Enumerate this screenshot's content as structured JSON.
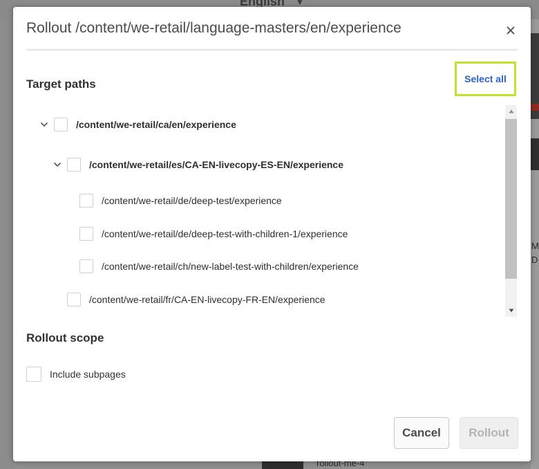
{
  "background": {
    "language_label": "English",
    "right_text_1": "M",
    "right_text_2": "D",
    "bottom_item_label": "rollout-me-4"
  },
  "dialog": {
    "title": "Rollout /content/we-retail/language-masters/en/experience",
    "close_icon": "close-icon",
    "target_paths": {
      "heading": "Target paths",
      "select_all_label": "Select all",
      "items": [
        {
          "path": "/content/we-retail/ca/en/experience",
          "expanded": true,
          "checked": false
        },
        {
          "path": "/content/we-retail/es/CA-EN-livecopy-ES-EN/experience",
          "expanded": true,
          "checked": false
        },
        {
          "path": "/content/we-retail/de/deep-test/experience",
          "checked": false
        },
        {
          "path": "/content/we-retail/de/deep-test-with-children-1/experience",
          "checked": false
        },
        {
          "path": "/content/we-retail/ch/new-label-test-with-children/experience",
          "checked": false
        },
        {
          "path": "/content/we-retail/fr/CA-EN-livecopy-FR-EN/experience",
          "checked": false
        }
      ]
    },
    "rollout_scope": {
      "heading": "Rollout scope",
      "include_subpages_label": "Include subpages",
      "include_subpages_checked": false
    },
    "buttons": {
      "cancel_label": "Cancel",
      "rollout_label": "Rollout",
      "rollout_disabled": true
    }
  },
  "colors": {
    "highlight": "#c5e12a",
    "link": "#2c63c9",
    "disabled_text": "#b3b3b3"
  }
}
